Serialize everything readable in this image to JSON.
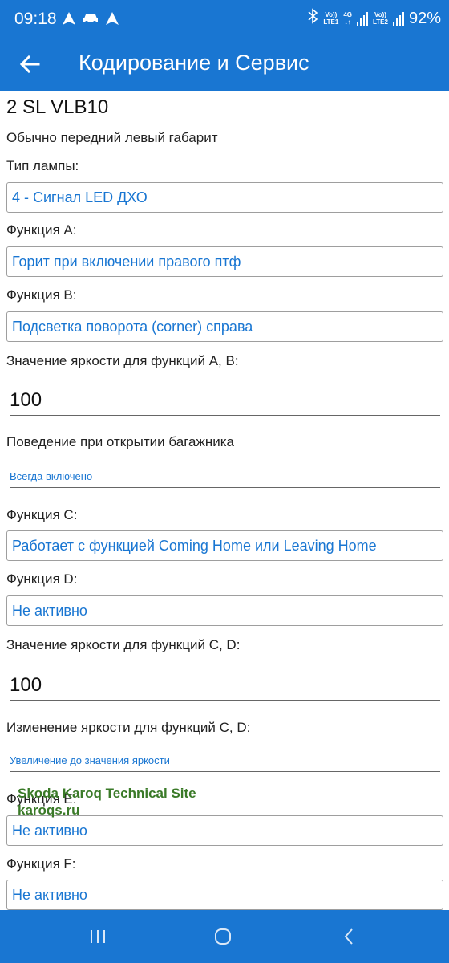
{
  "status_bar": {
    "time": "09:18",
    "left_icons": [
      "navigation-icon",
      "car-icon",
      "navigation-icon"
    ],
    "right_icons": [
      "bluetooth-icon",
      "volte-lte1-icon",
      "4g-icon",
      "signal-icon",
      "volte-lte2-icon",
      "signal-icon"
    ],
    "lte1_top": "Vo))",
    "lte1_bottom": "LTE1",
    "net_top": "4G",
    "net_bottom": "↓↑",
    "lte2_top": "Vo))",
    "lte2_bottom": "LTE2",
    "battery": "92%"
  },
  "app_bar": {
    "back_icon": "arrow-left-icon",
    "title": "Кодирование и Сервис"
  },
  "content": {
    "heading": "2 SL VLB10",
    "subtitle": "Обычно передний левый габарит",
    "lamp_type_label": "Тип лампы:",
    "lamp_type_value": "4 - Сигнал LED ДХО",
    "function_a_label": "Функция A:",
    "function_a_value": "Горит при включении правого птф",
    "function_b_label": "Функция B:",
    "function_b_value": "Подсветка поворота (corner) справа",
    "brightness_ab_label": "Значение яркости для функций A, B:",
    "brightness_ab_value": "100",
    "trunk_label": "Поведение при открытии багажника",
    "trunk_value": "Всегда включено",
    "function_c_label": "Функция C:",
    "function_c_value": "Работает с функцией Coming Home или Leaving Home",
    "function_d_label": "Функция D:",
    "function_d_value": "Не активно",
    "brightness_cd_label": "Значение яркости для функций C, D:",
    "brightness_cd_value": "100",
    "brightness_change_label": "Изменение яркости для функций C, D:",
    "brightness_change_value": "Увеличение до значения яркости",
    "function_e_label": "Функция E:",
    "function_e_value": "Не активно",
    "function_f_label": "Функция F:",
    "function_f_value": "Не активно"
  },
  "watermark": {
    "line1": "Skoda Karoq Technical Site",
    "line2": "karoqs.ru"
  },
  "nav_bar": {
    "icons": [
      "recent-apps-icon",
      "home-icon",
      "back-icon"
    ]
  },
  "colors": {
    "accent": "#1976d2",
    "watermark": "#3a7a28"
  }
}
